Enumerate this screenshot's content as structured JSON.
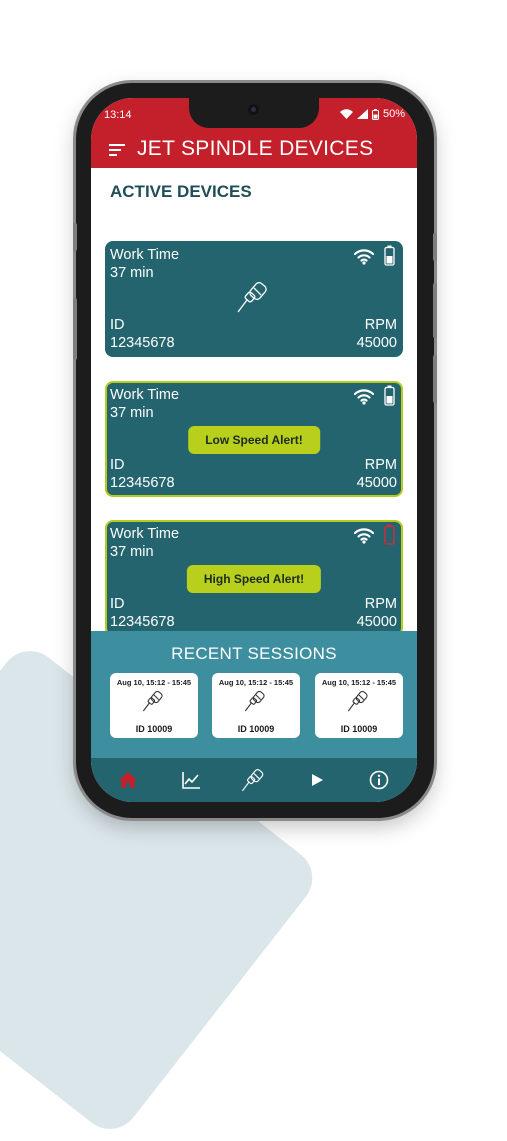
{
  "status_bar": {
    "time": "13:14",
    "battery": "50%"
  },
  "app": {
    "title": "JET SPINDLE DEVICES"
  },
  "section": {
    "title": "ACTIVE DEVICES"
  },
  "devices": [
    {
      "work_time_label": "Work Time",
      "work_time": "37 min",
      "id_label": "ID",
      "id": "12345678",
      "rpm_label": "RPM",
      "rpm": "45000",
      "alert": "",
      "battery_status": "normal"
    },
    {
      "work_time_label": "Work Time",
      "work_time": "37 min",
      "id_label": "ID",
      "id": "12345678",
      "rpm_label": "RPM",
      "rpm": "45000",
      "alert": "Low Speed Alert!",
      "battery_status": "normal"
    },
    {
      "work_time_label": "Work Time",
      "work_time": "37 min",
      "id_label": "ID",
      "id": "12345678",
      "rpm_label": "RPM",
      "rpm": "45000",
      "alert": "High Speed Alert!",
      "battery_status": "low"
    }
  ],
  "recent_sessions": {
    "title": "RECENT SESSIONS",
    "items": [
      {
        "date": "Aug 10, 15:12 - 15:45",
        "id": "ID 10009"
      },
      {
        "date": "Aug 10, 15:12 - 15:45",
        "id": "ID 10009"
      },
      {
        "date": "Aug 10, 15:12 - 15:45",
        "id": "ID 10009"
      }
    ]
  },
  "bottom_nav": {
    "items": [
      {
        "icon": "home-icon",
        "active": true
      },
      {
        "icon": "chart-icon",
        "active": false
      },
      {
        "icon": "spindle-icon",
        "active": false
      },
      {
        "icon": "play-icon",
        "active": false
      },
      {
        "icon": "info-icon",
        "active": false
      }
    ]
  },
  "colors": {
    "header": "#c4202b",
    "card": "#23646f",
    "alert_border": "#b6cc1a",
    "alert_pill": "#b8cf1b",
    "recent_panel": "#3d8fa0",
    "section_title": "#1f4f56",
    "battery_low": "#e0263a"
  }
}
